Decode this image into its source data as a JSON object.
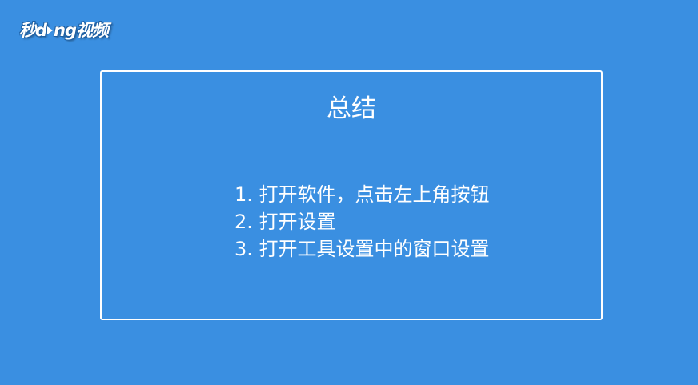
{
  "logo": {
    "part1": "秒d",
    "part2": "ng视频",
    "icon": "play-icon"
  },
  "summary": {
    "title": "总结",
    "steps": [
      "1. 打开软件，点击左上角按钮",
      "2. 打开设置",
      "3. 打开工具设置中的窗口设置"
    ]
  },
  "colors": {
    "background": "#3a8fe1",
    "text": "#ffffff",
    "border": "#ffffff"
  }
}
